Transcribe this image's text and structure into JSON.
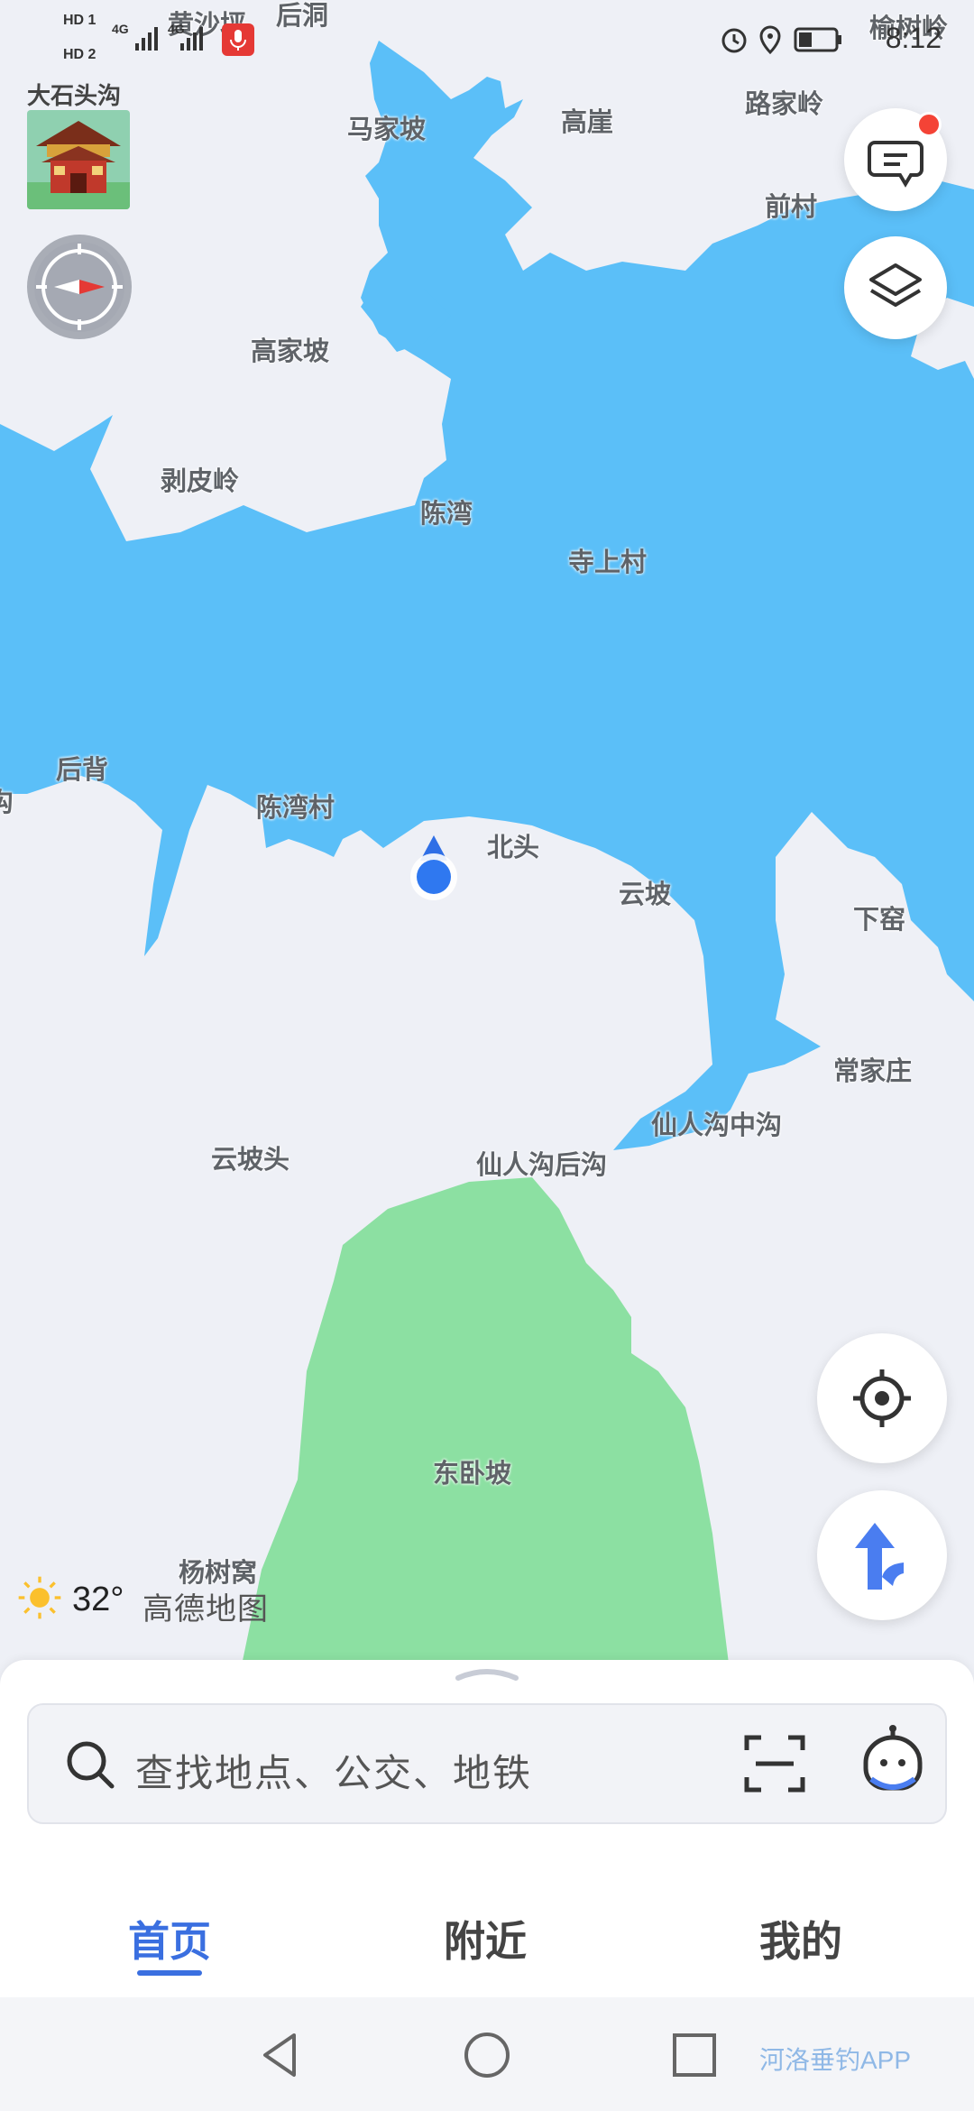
{
  "status_bar": {
    "hd1": "HD 1",
    "hd2": "HD 2",
    "net1": "4G",
    "net2": "4G",
    "time": "8:12"
  },
  "widget": {
    "place_title": "大石头沟"
  },
  "map": {
    "labels": {
      "huangshaping": "黄沙坪",
      "houdong": "后洞",
      "yushuling": "榆树岭",
      "majiapo": "马家坡",
      "gaoya": "高崖",
      "lujialing": "路家岭",
      "qiancun": "前村",
      "gaojiapo": "高家坡",
      "bopiling": "剥皮岭",
      "chenwan": "陈湾",
      "sishangcun": "寺上村",
      "houbei": "后背",
      "gou": "沟",
      "chenwancun": "陈湾村",
      "beitou": "北头",
      "yunpo": "云坡",
      "xiayao": "下窑",
      "changjiazhuang": "常家庄",
      "xianrengouzhonggou": "仙人沟中沟",
      "xianrengouhougou": "仙人沟后沟",
      "yunpotou": "云坡头",
      "dongwopo": "东卧坡",
      "yangshuwo": "杨树窝"
    },
    "colors": {
      "water": "#5bbff8",
      "forest": "#8ce0a2",
      "land": "#eef0f6",
      "accent": "#3a6fe0"
    }
  },
  "buttons": {
    "messages_icon": "chat-icon",
    "layers_icon": "layers-icon",
    "locate_icon": "crosshair-icon",
    "route_icon": "route-arrow-icon"
  },
  "weather": {
    "icon": "sun-icon",
    "temperature": "32°",
    "brand": "高德地图"
  },
  "search": {
    "placeholder": "查找地点、公交、地铁",
    "scan_icon": "scan-icon",
    "assistant_icon": "assistant-icon"
  },
  "tabs": [
    {
      "label": "首页"
    },
    {
      "label": "附近"
    },
    {
      "label": "我的"
    }
  ],
  "system_nav": {
    "watermark": "河洛垂钓APP"
  }
}
